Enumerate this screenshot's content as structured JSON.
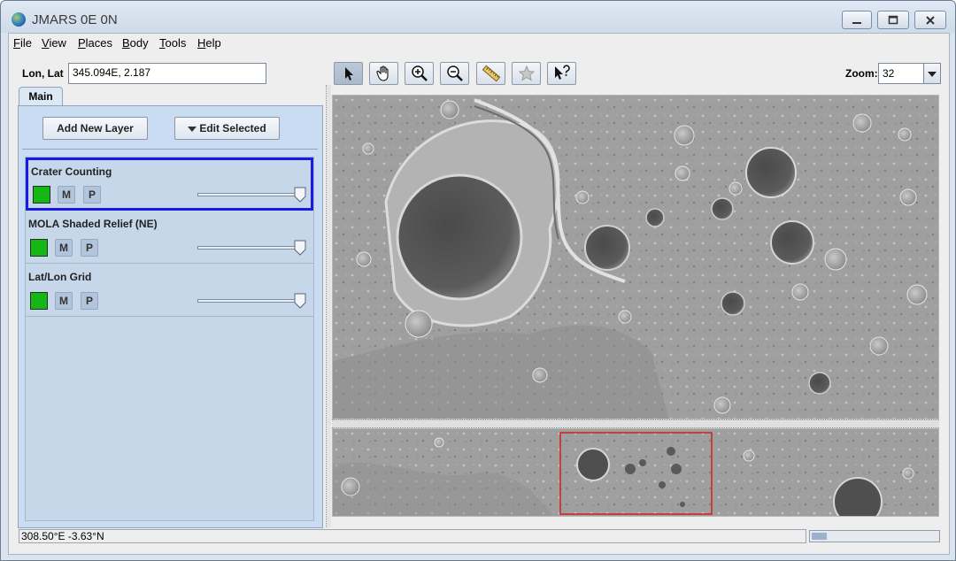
{
  "window": {
    "title": "JMARS 0E 0N"
  },
  "menu": [
    "File",
    "View",
    "Places",
    "Body",
    "Tools",
    "Help"
  ],
  "position": {
    "label": "Lon, Lat",
    "value": "345.094E, 2.187"
  },
  "tabs": [
    "Main"
  ],
  "buttons": {
    "add_layer": "Add New Layer",
    "edit_selected": "Edit Selected"
  },
  "layers": [
    {
      "name": "Crater Counting",
      "m": "M",
      "p": "P",
      "selected": true,
      "opacity": 1.0
    },
    {
      "name": "MOLA Shaded Relief (NE)",
      "m": "M",
      "p": "P",
      "selected": false,
      "opacity": 1.0
    },
    {
      "name": "Lat/Lon Grid",
      "m": "M",
      "p": "P",
      "selected": false,
      "opacity": 1.0
    }
  ],
  "toolbar": {
    "tools": [
      "select-pointer-icon",
      "pan-hand-icon",
      "zoom-in-icon",
      "zoom-out-icon",
      "ruler-icon",
      "investigate-star-icon",
      "whats-this-icon"
    ],
    "zoom_label": "Zoom:",
    "zoom_value": "32"
  },
  "status": {
    "coords": "308.50°E   -3.63°N",
    "progress": 0.12
  },
  "colors": {
    "layer_color": "#14b814",
    "selection_border": "#1a1ae6",
    "panner_box": "#d02020"
  }
}
